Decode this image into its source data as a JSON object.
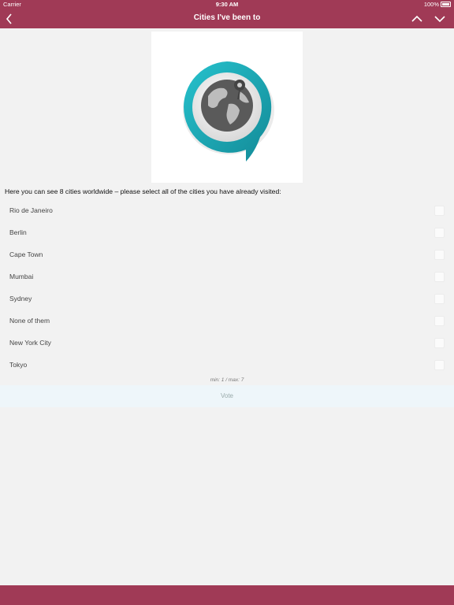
{
  "status": {
    "carrier": "Carrier",
    "time": "9:30 AM",
    "battery": "100%"
  },
  "nav": {
    "title": "Cities I've been to",
    "back_icon": "chevron-left-icon",
    "up_icon": "chevron-up-icon",
    "down_icon": "chevron-down-icon"
  },
  "hero": {
    "icon": "globe-speech-bubble-logo",
    "accent": "#1aa6b4"
  },
  "question": "Here you can see 8 cities worldwide – please select all of the cities you have already visited:",
  "options": [
    {
      "label": "Rio de Janeiro",
      "checked": false
    },
    {
      "label": "Berlin",
      "checked": false
    },
    {
      "label": "Cape Town",
      "checked": false
    },
    {
      "label": "Mumbai",
      "checked": false
    },
    {
      "label": "Sydney",
      "checked": false
    },
    {
      "label": "None of them",
      "checked": false
    },
    {
      "label": "New York City",
      "checked": false
    },
    {
      "label": "Tokyo",
      "checked": false
    }
  ],
  "constraint": "min: 1 / max: 7",
  "vote_label": "Vote",
  "colors": {
    "brand": "#a03a56",
    "background": "#f2f2f2",
    "vote_bg": "#eef6fa"
  }
}
